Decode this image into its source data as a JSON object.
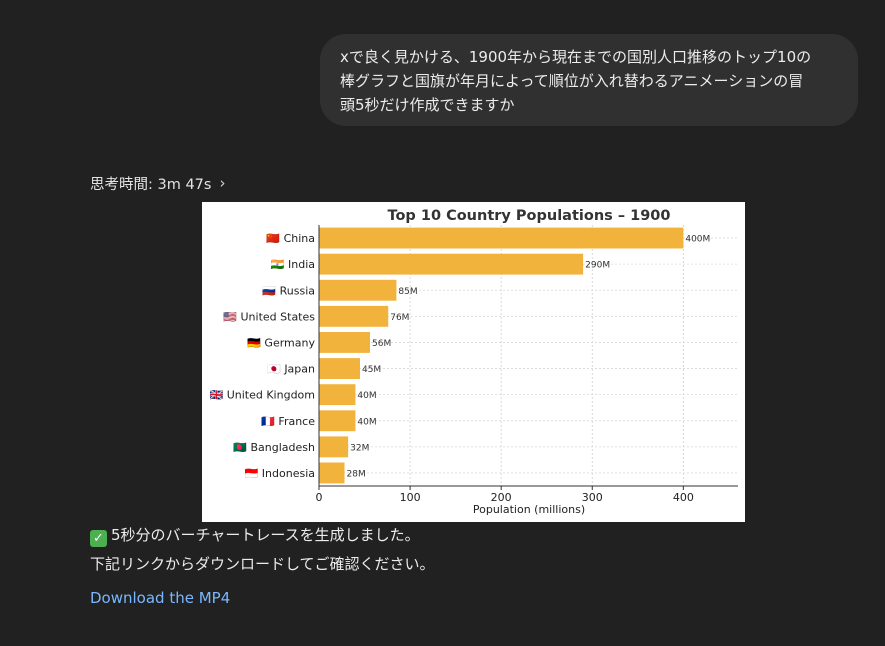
{
  "user_message": {
    "lines": [
      "xで良く見かける、1900年から現在までの国別人口推移のトップ10の",
      "棒グラフと国旗が年月によって順位が入れ替わるアニメーションの冒",
      "頭5秒だけ作成できますか"
    ]
  },
  "thinking": {
    "label": "思考時間: 3m 47s",
    "chevron": "›"
  },
  "colors": {
    "bar": "#f2b33d",
    "background": "#212121",
    "link": "#7ab7ff"
  },
  "chart_data": {
    "type": "bar",
    "orientation": "horizontal",
    "title": "Top 10 Country Populations – 1900",
    "xlabel": "Population (millions)",
    "ylabel": "",
    "xlim": [
      0,
      460
    ],
    "xticks": [
      0,
      100,
      200,
      300,
      400
    ],
    "grid": true,
    "categories": [
      "🇨🇳 China",
      "🇮🇳 India",
      "🇷🇺 Russia",
      "🇺🇸 United States",
      "🇩🇪 Germany",
      "🇯🇵 Japan",
      "🇬🇧 United Kingdom",
      "🇫🇷 France",
      "🇧🇩 Bangladesh",
      "🇮🇩 Indonesia"
    ],
    "values": [
      400,
      290,
      85,
      76,
      56,
      45,
      40,
      40,
      32,
      28
    ],
    "value_labels": [
      "400M",
      "290M",
      "85M",
      "76M",
      "56M",
      "45M",
      "40M",
      "40M",
      "32M",
      "28M"
    ]
  },
  "assistant_message": {
    "check_icon": "✓",
    "line1": "5秒分のバーチャートレースを生成しました。",
    "line2": "下記リンクからダウンロードしてご確認ください。",
    "link_label": "Download the MP4"
  }
}
